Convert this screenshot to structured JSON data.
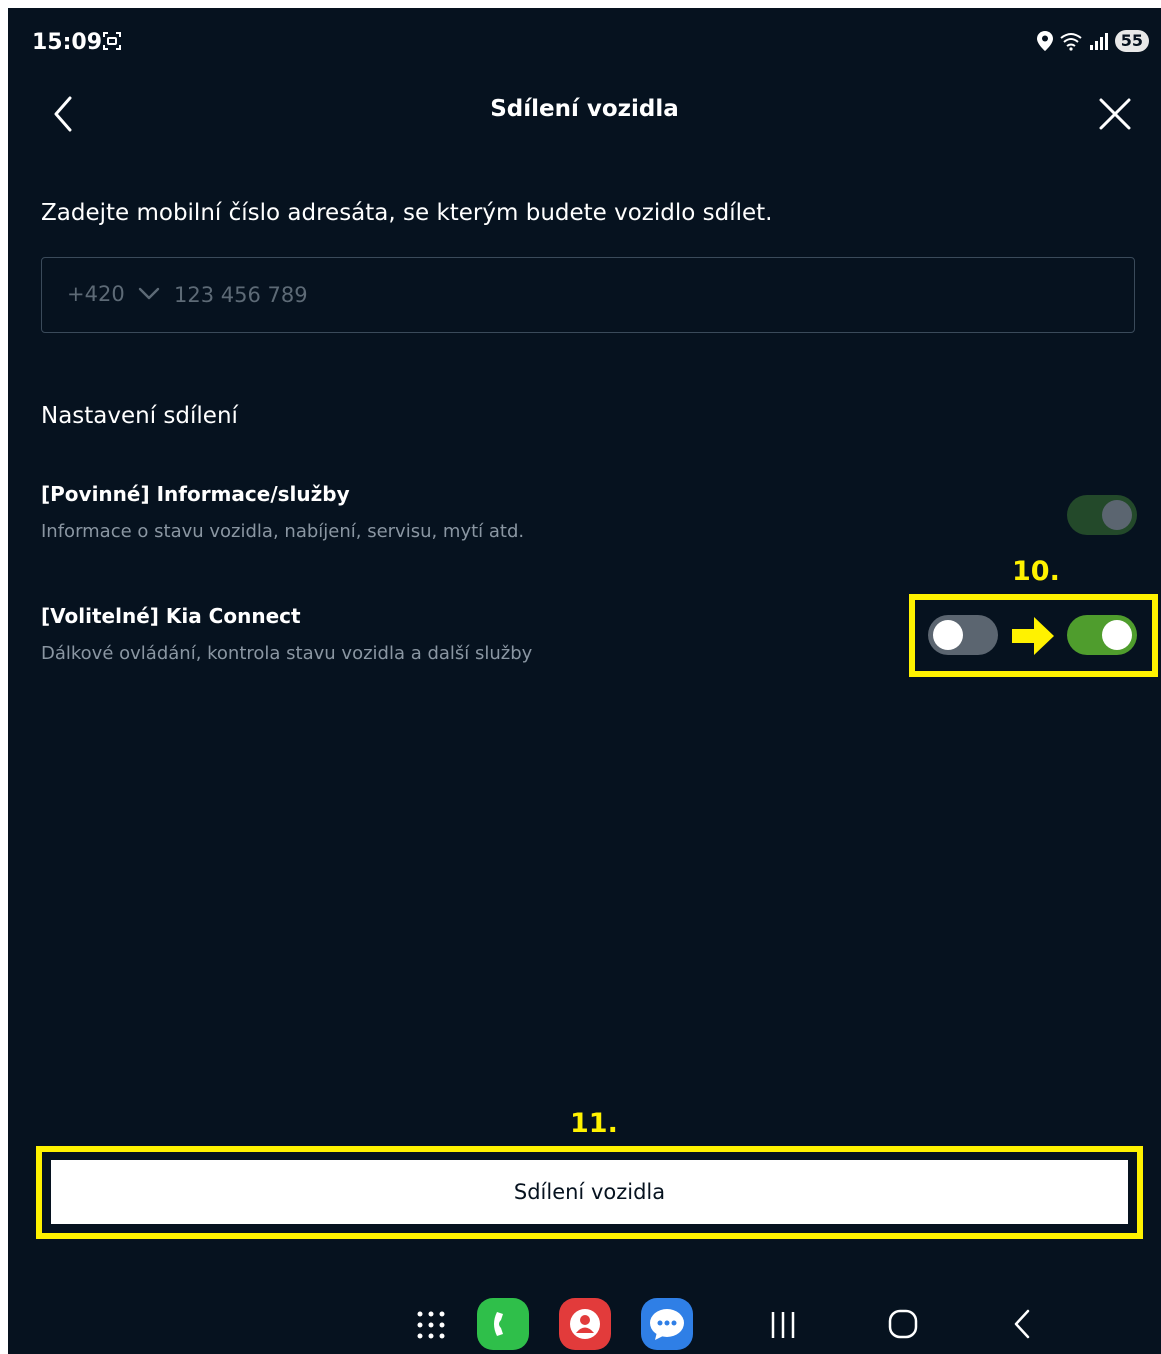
{
  "status_bar": {
    "time": "15:09",
    "battery": "55"
  },
  "header": {
    "title": "Sdílení vozidla"
  },
  "instruction": "Zadejte mobilní číslo adresáta, se kterým budete vozidlo sdílet.",
  "phone": {
    "country_code": "+420",
    "placeholder": "123 456 789"
  },
  "settings": {
    "section_title": "Nastavení sdílení",
    "items": [
      {
        "title": "[Povinné] Informace/služby",
        "description": "Informace o stavu vozidla, nabíjení, servisu, mytí atd.",
        "enabled": true,
        "disabled": true
      },
      {
        "title": "[Volitelné] Kia Connect",
        "description": "Dálkové ovládání, kontrola stavu vozidla a další služby",
        "enabled_before": false,
        "enabled_after": true
      }
    ]
  },
  "annotations": {
    "step_toggle": "10.",
    "step_button": "11."
  },
  "primary_button": {
    "label": "Sdílení vozidla"
  },
  "colors": {
    "background": "#06121f",
    "toggle_on": "#4f9d2d",
    "toggle_on_dim": "#23492a",
    "toggle_off": "#5b6570",
    "annotation": "#fff200"
  }
}
